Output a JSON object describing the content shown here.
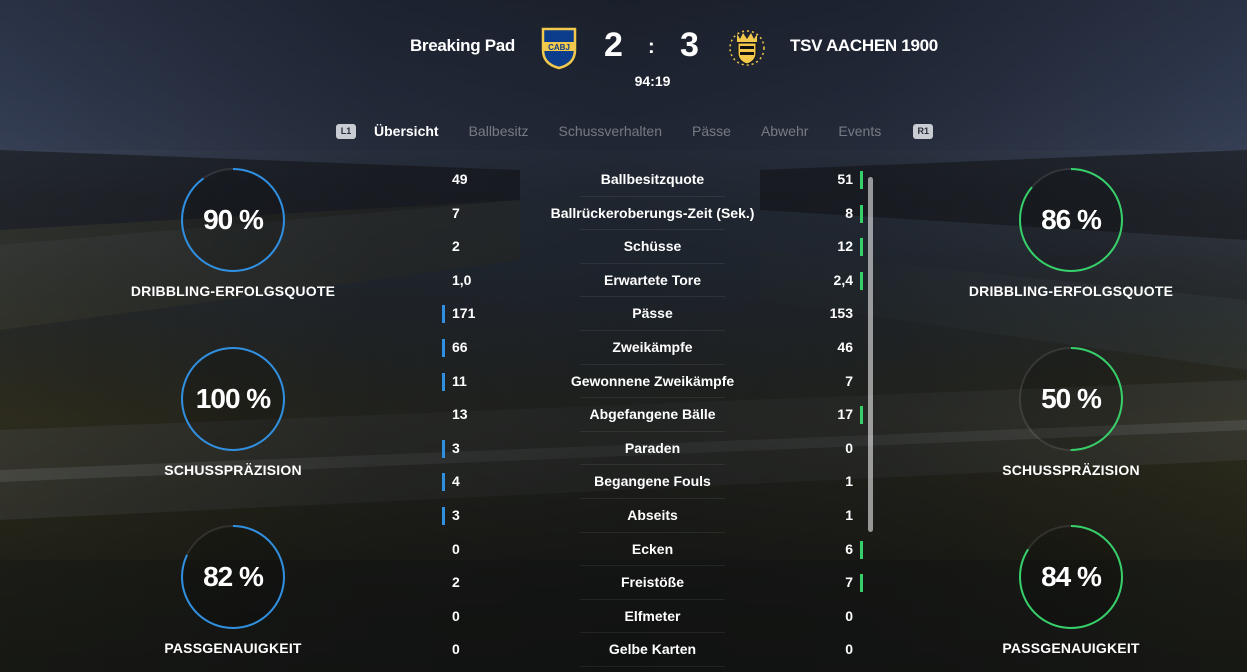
{
  "match": {
    "home_team": "Breaking Pad",
    "away_team": "TSV AACHEN 1900",
    "home_score": "2",
    "separator": ":",
    "away_score": "3",
    "clock": "94:19",
    "home_crest_text": "CABJ",
    "home_color": "#0b3d8c",
    "away_color": "#f2c94c"
  },
  "tabs": {
    "l1": "L1",
    "r1": "R1",
    "items": [
      "Übersicht",
      "Ballbesitz",
      "Schussverhalten",
      "Pässe",
      "Abwehr",
      "Events"
    ],
    "active": 0
  },
  "colors": {
    "home": "#2f8fe0",
    "away": "#36d06a"
  },
  "home_circles": [
    {
      "value": 90,
      "text": "90 %",
      "label": "DRIBBLING-ERFOLGSQUOTE"
    },
    {
      "value": 100,
      "text": "100 %",
      "label": "SCHUSSPRÄZISION"
    },
    {
      "value": 82,
      "text": "82 %",
      "label": "PASSGENAUIGKEIT"
    }
  ],
  "away_circles": [
    {
      "value": 86,
      "text": "86 %",
      "label": "DRIBBLING-ERFOLGSQUOTE"
    },
    {
      "value": 50,
      "text": "50 %",
      "label": "SCHUSSPRÄZISION"
    },
    {
      "value": 84,
      "text": "84 %",
      "label": "PASSGENAUIGKEIT"
    }
  ],
  "stats": [
    {
      "name": "Ballbesitzquote",
      "home": "49",
      "away": "51",
      "leader": "away"
    },
    {
      "name": "Ballrückeroberungs-Zeit (Sek.)",
      "home": "7",
      "away": "8",
      "leader": "away"
    },
    {
      "name": "Schüsse",
      "home": "2",
      "away": "12",
      "leader": "away"
    },
    {
      "name": "Erwartete Tore",
      "home": "1,0",
      "away": "2,4",
      "leader": "away"
    },
    {
      "name": "Pässe",
      "home": "171",
      "away": "153",
      "leader": "home"
    },
    {
      "name": "Zweikämpfe",
      "home": "66",
      "away": "46",
      "leader": "home"
    },
    {
      "name": "Gewonnene Zweikämpfe",
      "home": "11",
      "away": "7",
      "leader": "home"
    },
    {
      "name": "Abgefangene Bälle",
      "home": "13",
      "away": "17",
      "leader": "away"
    },
    {
      "name": "Paraden",
      "home": "3",
      "away": "0",
      "leader": "home"
    },
    {
      "name": "Begangene Fouls",
      "home": "4",
      "away": "1",
      "leader": "home"
    },
    {
      "name": "Abseits",
      "home": "3",
      "away": "1",
      "leader": "home"
    },
    {
      "name": "Ecken",
      "home": "0",
      "away": "6",
      "leader": "away"
    },
    {
      "name": "Freistöße",
      "home": "2",
      "away": "7",
      "leader": "away"
    },
    {
      "name": "Elfmeter",
      "home": "0",
      "away": "0",
      "leader": "none"
    },
    {
      "name": "Gelbe Karten",
      "home": "0",
      "away": "0",
      "leader": "none"
    }
  ]
}
